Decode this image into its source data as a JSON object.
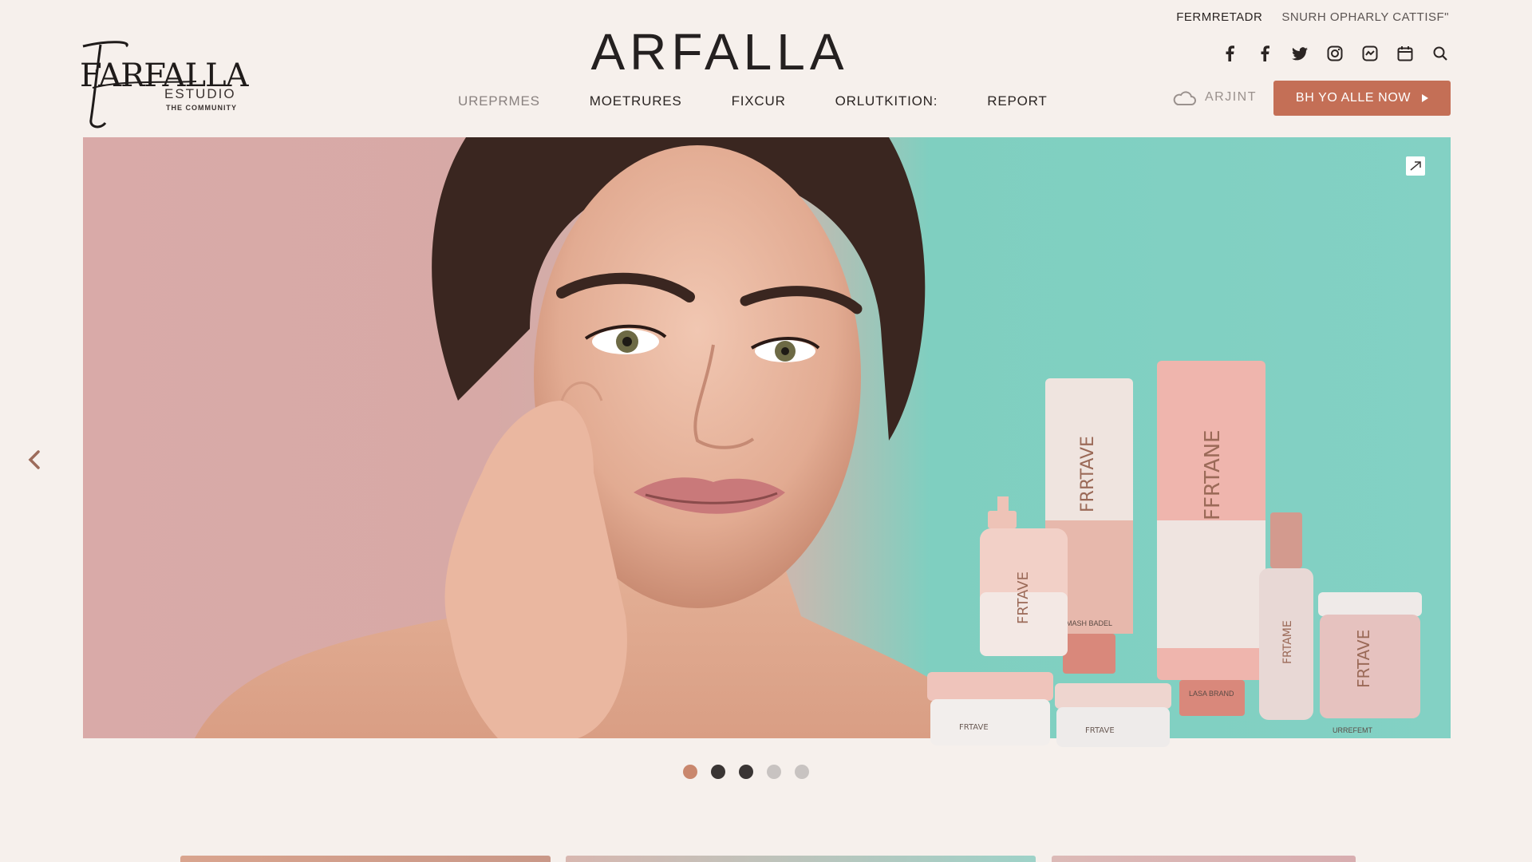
{
  "logo": {
    "main": "FARFALLA",
    "sub": "ESTUDIO",
    "tagline": "THE COMMUNITY"
  },
  "brand_title": "ARFALLA",
  "utility_links": [
    "FERMRETADR",
    "SNURH OPHARLY CATTISF\""
  ],
  "social_icons": [
    "facebook-icon",
    "facebook-icon",
    "twitter-icon",
    "instagram-icon",
    "messenger-icon",
    "calendar-icon",
    "search-icon"
  ],
  "nav": {
    "items": [
      "UREPRMES",
      "MOETRURES",
      "FIXCUR",
      "ORLUTKITION:",
      "REPORT"
    ]
  },
  "account": {
    "label": "ARJINT"
  },
  "cta": {
    "label": "BH YO ALLE NOW"
  },
  "hero": {
    "product_labels": [
      "FRRTAVE",
      "FFRTANE",
      "FRTAVE",
      "FRTAME",
      "FRTAVE",
      "FRTAVE",
      "FRTAVE"
    ],
    "small_labels": [
      "MASH BADEL",
      "LASA BRAND",
      "URREFEMT"
    ]
  },
  "carousel": {
    "count": 5,
    "active": 0
  },
  "colors": {
    "accent": "#c46f56",
    "background": "#f6f0ec",
    "hero_pink": "#d9aaa8",
    "hero_teal": "#83d1c4",
    "dot_active": "#c9876d",
    "dot_dark": "#3a3534",
    "dot_light": "#c8c3c1"
  }
}
